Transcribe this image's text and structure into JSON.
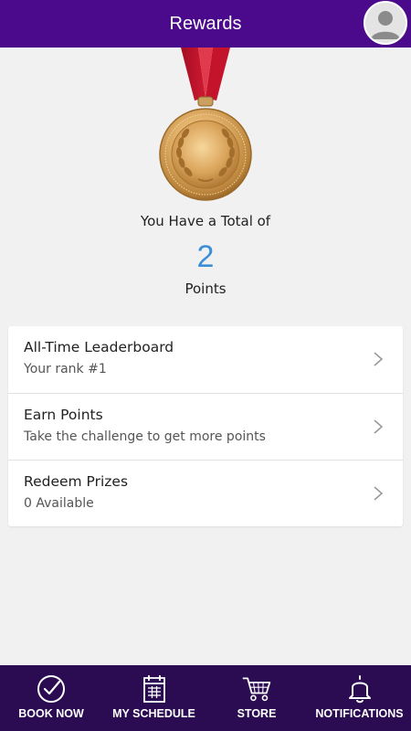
{
  "header": {
    "title": "Rewards",
    "profile_icon": "user-avatar-icon"
  },
  "medal_icon": "medal-icon",
  "points": {
    "label": "You Have a Total of",
    "value": "2",
    "unit": "Points"
  },
  "list": [
    {
      "title": "All-Time Leaderboard",
      "subtitle": "Your rank #1",
      "icon": "chevron-right-icon"
    },
    {
      "title": "Earn Points",
      "subtitle": "Take the challenge to get more points",
      "icon": "chevron-right-icon"
    },
    {
      "title": "Redeem Prizes",
      "subtitle": "0 Available",
      "icon": "chevron-right-icon"
    }
  ],
  "nav": [
    {
      "label": "BOOK NOW",
      "icon": "check-circle-icon"
    },
    {
      "label": "MY SCHEDULE",
      "icon": "calendar-icon"
    },
    {
      "label": "STORE",
      "icon": "cart-icon"
    },
    {
      "label": "NOTIFICATIONS",
      "icon": "bell-icon"
    }
  ],
  "colors": {
    "header_bg": "#4b0a8c",
    "nav_bg": "#2b0c52",
    "points_accent": "#3d8ed8",
    "ribbon": "#c8102e",
    "medal_gold": "#d9a55a"
  }
}
